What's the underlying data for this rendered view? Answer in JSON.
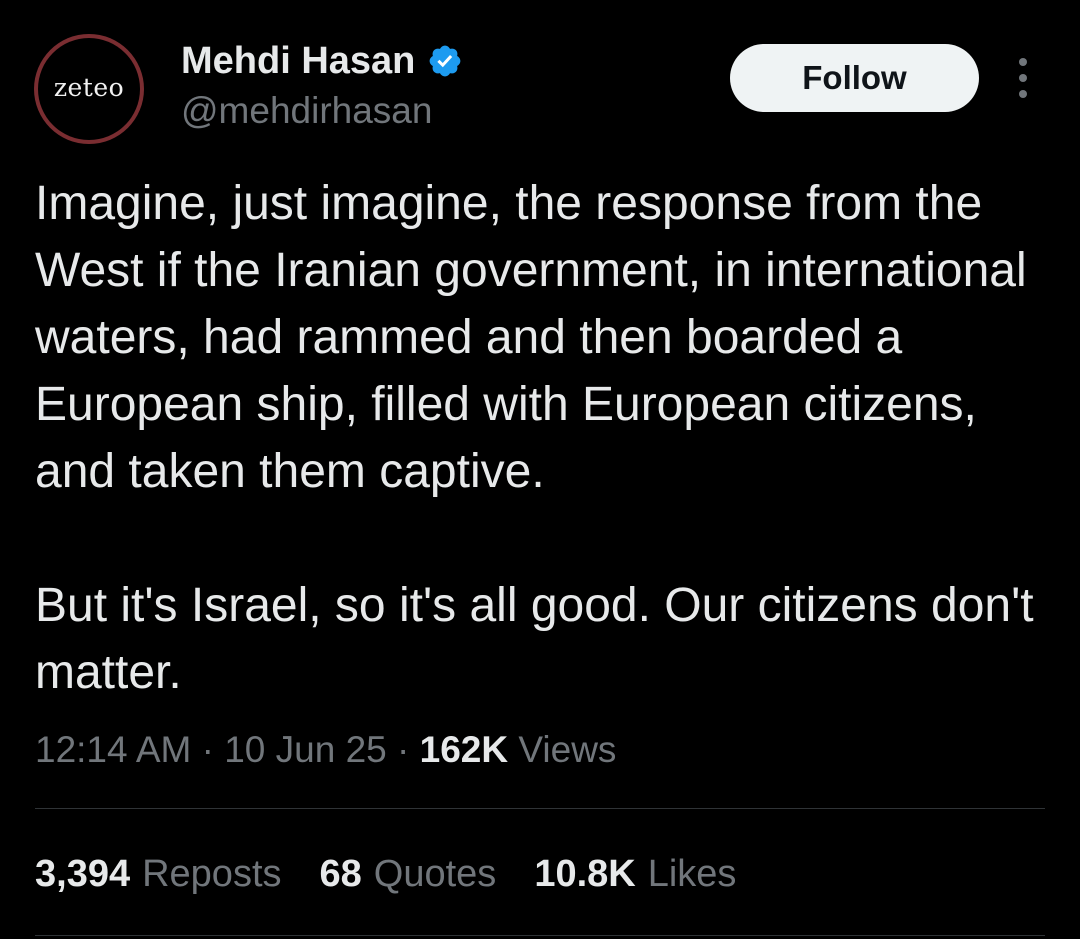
{
  "author": {
    "avatar_text": "zeteo",
    "display_name": "Mehdi Hasan",
    "handle": "@mehdirhasan",
    "verified_icon": "verified-badge-icon"
  },
  "header": {
    "follow_label": "Follow",
    "more_icon": "more-options-icon"
  },
  "tweet": {
    "paragraph_1": "Imagine, just imagine, the response from the West if the Iranian government, in international waters, had rammed and then boarded a European ship, filled with European citizens, and taken them captive.",
    "paragraph_2": "But it's Israel, so it's all good. Our citizens don't matter."
  },
  "meta": {
    "time": "12:14 AM",
    "separator": "·",
    "date": "10 Jun 25",
    "views_count": "162K",
    "views_label": "Views"
  },
  "stats": {
    "reposts_count": "3,394",
    "reposts_label": "Reposts",
    "quotes_count": "68",
    "quotes_label": "Quotes",
    "likes_count": "10.8K",
    "likes_label": "Likes"
  },
  "colors": {
    "background": "#000000",
    "primary_text": "#e7e9ea",
    "secondary_text": "#71767b",
    "verified_blue": "#1d9bf0",
    "follow_button_bg": "#eff3f4",
    "avatar_ring": "#7a2d31",
    "divider": "#2f3336"
  }
}
